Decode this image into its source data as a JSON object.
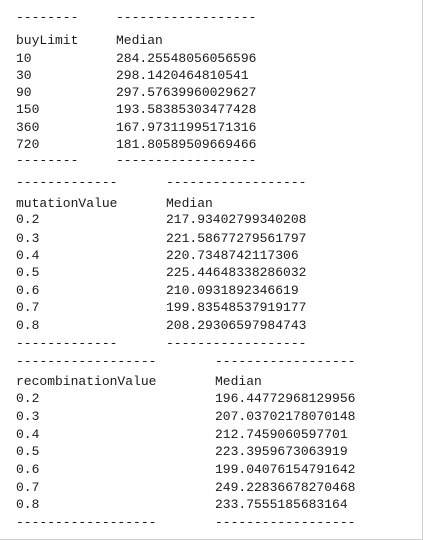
{
  "tables": [
    {
      "separator_key": "--------",
      "separator_value": "------------------",
      "header_key": "buyLimit",
      "header_value": "Median",
      "rows": [
        {
          "key": "10",
          "value": "284.25548056056596"
        },
        {
          "key": "30",
          "value": "298.1420464810541"
        },
        {
          "key": "90",
          "value": "297.57639960029627"
        },
        {
          "key": "150",
          "value": "193.58385303477428"
        },
        {
          "key": "360",
          "value": "167.97311995171316"
        },
        {
          "key": "720",
          "value": "181.80589509669466"
        }
      ]
    },
    {
      "separator_key": "-------------",
      "separator_value": "------------------",
      "header_key": "mutationValue",
      "header_value": "Median",
      "rows": [
        {
          "key": "0.2",
          "value": "217.93402799340208"
        },
        {
          "key": "0.3",
          "value": "221.58677279561797"
        },
        {
          "key": "0.4",
          "value": "220.7348742117306"
        },
        {
          "key": "0.5",
          "value": "225.44648338286032"
        },
        {
          "key": "0.6",
          "value": "210.0931892346619"
        },
        {
          "key": "0.7",
          "value": "199.83548537919177"
        },
        {
          "key": "0.8",
          "value": "208.29306597984743"
        }
      ]
    },
    {
      "separator_key": "------------------",
      "separator_value": "------------------",
      "header_key": "recombinationValue",
      "header_value": "Median",
      "rows": [
        {
          "key": "0.2",
          "value": "196.44772968129956"
        },
        {
          "key": "0.3",
          "value": "207.03702178070148"
        },
        {
          "key": "0.4",
          "value": "212.7459060597701"
        },
        {
          "key": "0.5",
          "value": "223.3959673063919"
        },
        {
          "key": "0.6",
          "value": "199.04076154791642"
        },
        {
          "key": "0.7",
          "value": "249.22836678270468"
        },
        {
          "key": "0.8",
          "value": "233.7555185683164"
        }
      ]
    }
  ]
}
